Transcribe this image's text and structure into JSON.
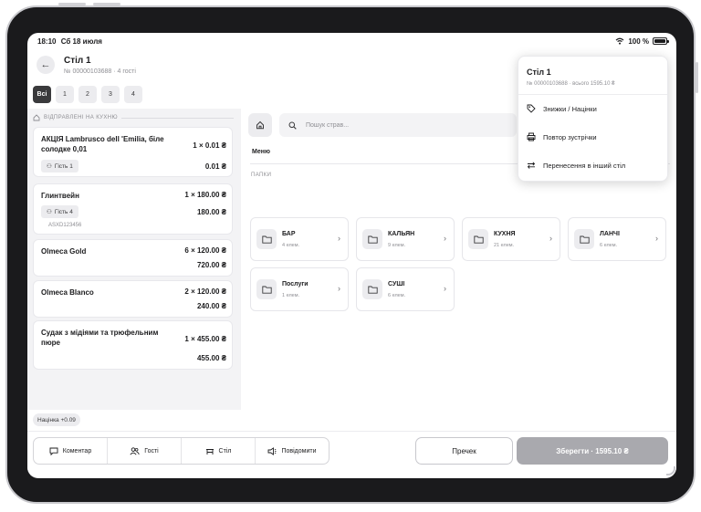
{
  "status": {
    "time": "18:10",
    "date": "Сб 18 июля",
    "battery": "100 %"
  },
  "header": {
    "title": "Стіл 1",
    "subtitle": "№ 00000103688 · 4 гості"
  },
  "guest_tabs": [
    "Всі",
    "1",
    "2",
    "3",
    "4"
  ],
  "orders_section": "ВІДПРАВЛЕНІ НА КУХНЮ",
  "orders": [
    {
      "name": "АКЦІЯ Lambrusco dell 'Emilia, біле солодке 0,01",
      "qty": "1 × 0.01 ₴",
      "total": "0.01 ₴",
      "guest": "Гість 1"
    },
    {
      "name": "Глинтвейн",
      "qty": "1 × 180.00 ₴",
      "total": "180.00 ₴",
      "guest": "Гість 4",
      "code": "ASXD123456"
    },
    {
      "name": "Olmeca Gold",
      "qty": "6 × 120.00 ₴",
      "total": "720.00 ₴"
    },
    {
      "name": "Olmeca Blanco",
      "qty": "2 × 120.00 ₴",
      "total": "240.00 ₴"
    },
    {
      "name": "Судак з мідіями та трюфельним пюре",
      "qty": "1 × 455.00 ₴",
      "total": "455.00 ₴"
    }
  ],
  "surcharge_badge": "Націнка +0.09",
  "search": {
    "placeholder": "Пошук страв..."
  },
  "menu_label": "Меню",
  "folders_label": "ПАПКИ",
  "folders": [
    {
      "name": "БАР",
      "count": "4 елем."
    },
    {
      "name": "КАЛЬЯН",
      "count": "9 елем."
    },
    {
      "name": "КУХНЯ",
      "count": "21 елем."
    },
    {
      "name": "ЛАНЧІ",
      "count": "6 елем."
    },
    {
      "name": "Послуги",
      "count": "1 елем."
    },
    {
      "name": "СУШІ",
      "count": "6 елем."
    }
  ],
  "bottom": {
    "comment": "Коментар",
    "guests": "Гості",
    "table": "Стіл",
    "notify": "Повідомити",
    "recheck": "Пречек",
    "save": "Зберегти · 1595.10 ₴"
  },
  "popover": {
    "title": "Стіл 1",
    "subtitle": "№ 00000103688 · всього 1595.10 ₴",
    "items": [
      "Знижки / Націнки",
      "Повтор зустрічки",
      "Перенесення в інший стіл"
    ]
  },
  "colors": {
    "accent_dark": "#3a3a3c",
    "save_button": "#a9a9ae",
    "panel_bg": "#f3f3f5"
  }
}
